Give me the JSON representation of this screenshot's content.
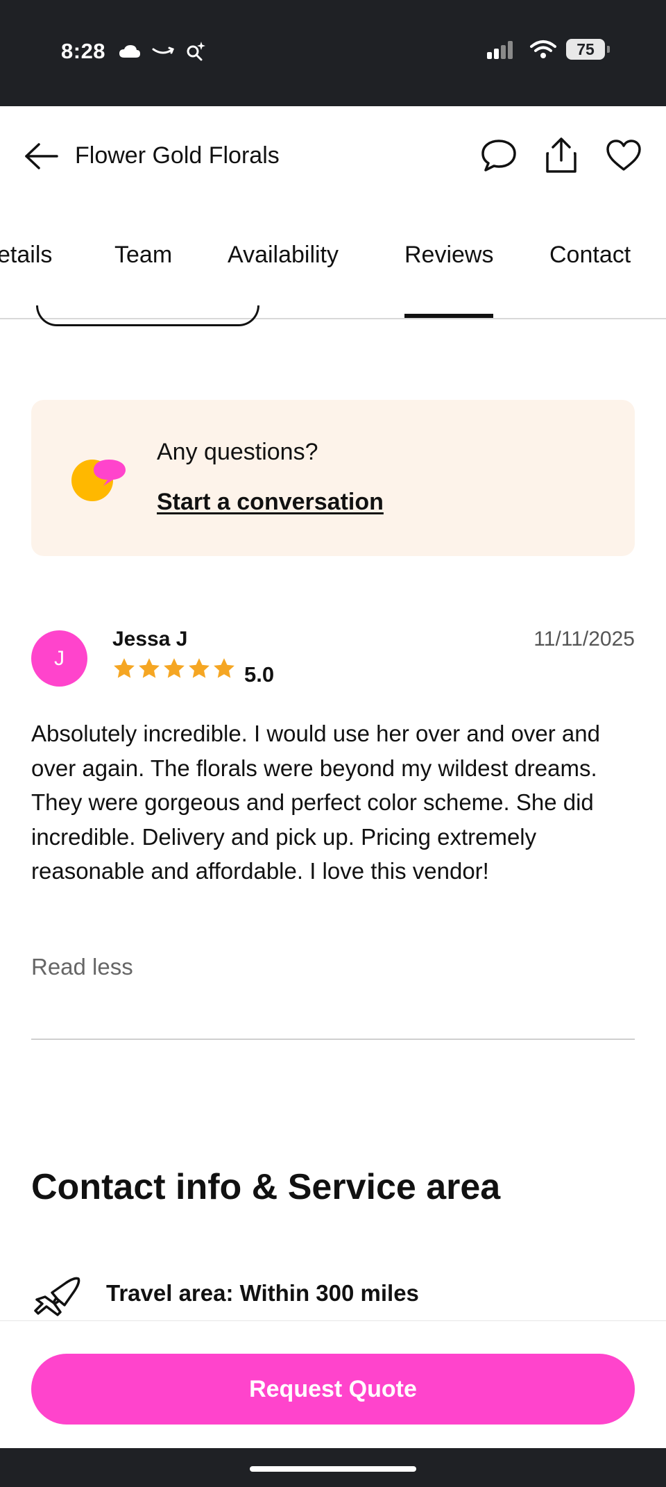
{
  "status_bar": {
    "time": "8:28",
    "battery": "75",
    "left_icons": [
      "cloud-icon",
      "amazon-smile-icon",
      "search-sparkle-icon"
    ],
    "right_icons": [
      "signal-icon",
      "wifi-icon",
      "battery-icon"
    ]
  },
  "header": {
    "title": "Flower Gold Florals",
    "actions": [
      "chat-icon",
      "share-icon",
      "heart-icon"
    ]
  },
  "tabs": [
    {
      "label": "etails"
    },
    {
      "label": "Team"
    },
    {
      "label": "Availability"
    },
    {
      "label": "Reviews",
      "active": true
    },
    {
      "label": "Contact"
    }
  ],
  "question_card": {
    "question": "Any questions?",
    "link": "Start a conversation"
  },
  "review": {
    "avatar_initial": "J",
    "name": "Jessa J",
    "rating": "5.0",
    "stars": 5,
    "date": "11/11/2025",
    "text": "Absolutely incredible. I would use her over and over and over again. The florals were beyond my wildest dreams. They were gorgeous and perfect color scheme. She did incredible. Delivery and pick up. Pricing extremely reasonable and affordable. I love this vendor!",
    "read_less": "Read less"
  },
  "contact_section": {
    "title": "Contact info & Service area",
    "travel_area": "Travel area: Within 300 miles"
  },
  "cta": {
    "label": "Request Quote"
  },
  "colors": {
    "accent": "#ff44cc",
    "status_bar": "#1f2125",
    "card_bg": "#fdf3ea",
    "star": "#f5a623"
  }
}
